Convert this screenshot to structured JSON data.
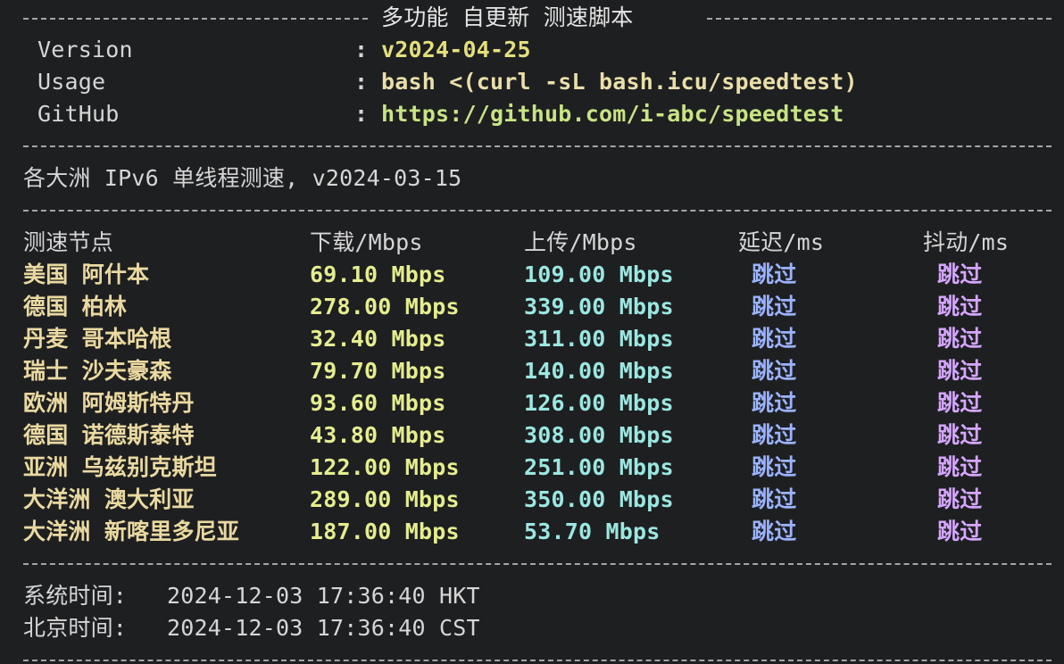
{
  "header": {
    "title": "多功能 自更新 测速脚本"
  },
  "meta": [
    {
      "label": "Version",
      "colon": ":",
      "value": "v2024-04-25",
      "color": "#e3df7c"
    },
    {
      "label": "Usage",
      "colon": ":",
      "value": "bash <(curl -sL bash.icu/speedtest)",
      "color": "#eadfa9"
    },
    {
      "label": "GitHub",
      "colon": ":",
      "value": "https://github.com/i-abc/speedtest",
      "color": "#c8e484"
    }
  ],
  "section": {
    "title": "各大洲 IPv6 单线程测速, v2024-03-15"
  },
  "table": {
    "headers": {
      "node": "测速节点",
      "download": "下载/Mbps",
      "upload": "上传/Mbps",
      "latency": "延迟/ms",
      "jitter": "抖动/ms"
    },
    "rows": [
      {
        "node": "美国 阿什本",
        "download": "69.10 Mbps",
        "upload": "109.00 Mbps",
        "latency": "跳过",
        "jitter": "跳过"
      },
      {
        "node": "德国 柏林",
        "download": "278.00 Mbps",
        "upload": "339.00 Mbps",
        "latency": "跳过",
        "jitter": "跳过"
      },
      {
        "node": "丹麦 哥本哈根",
        "download": "32.40 Mbps",
        "upload": "311.00 Mbps",
        "latency": "跳过",
        "jitter": "跳过"
      },
      {
        "node": "瑞士 沙夫豪森",
        "download": "79.70 Mbps",
        "upload": "140.00 Mbps",
        "latency": "跳过",
        "jitter": "跳过"
      },
      {
        "node": "欧洲 阿姆斯特丹",
        "download": "93.60 Mbps",
        "upload": "126.00 Mbps",
        "latency": "跳过",
        "jitter": "跳过"
      },
      {
        "node": "德国 诺德斯泰特",
        "download": "43.80 Mbps",
        "upload": "308.00 Mbps",
        "latency": "跳过",
        "jitter": "跳过"
      },
      {
        "node": "亚洲 乌兹别克斯坦",
        "download": "122.00 Mbps",
        "upload": "251.00 Mbps",
        "latency": "跳过",
        "jitter": "跳过"
      },
      {
        "node": "大洋洲 澳大利亚",
        "download": "289.00 Mbps",
        "upload": "350.00 Mbps",
        "latency": "跳过",
        "jitter": "跳过"
      },
      {
        "node": "大洋洲 新喀里多尼亚",
        "download": "187.00 Mbps",
        "upload": "53.70 Mbps",
        "latency": "跳过",
        "jitter": "跳过"
      }
    ]
  },
  "footer": {
    "system_time_label": "系统时间:",
    "system_time_value": "2024-12-03 17:36:40 HKT",
    "beijing_time_label": "北京时间:",
    "beijing_time_value": "2024-12-03 17:36:40 CST"
  },
  "colors": {
    "background": "#1e1f21",
    "text": "#d6d6d6",
    "version": "#e3df7c",
    "usage": "#eadfa9",
    "github": "#c8e484",
    "node": "#ead9a0",
    "download": "#e5ed8f",
    "upload": "#9be7e1",
    "latency": "#9bb3ff",
    "jitter": "#d5a6ff"
  }
}
